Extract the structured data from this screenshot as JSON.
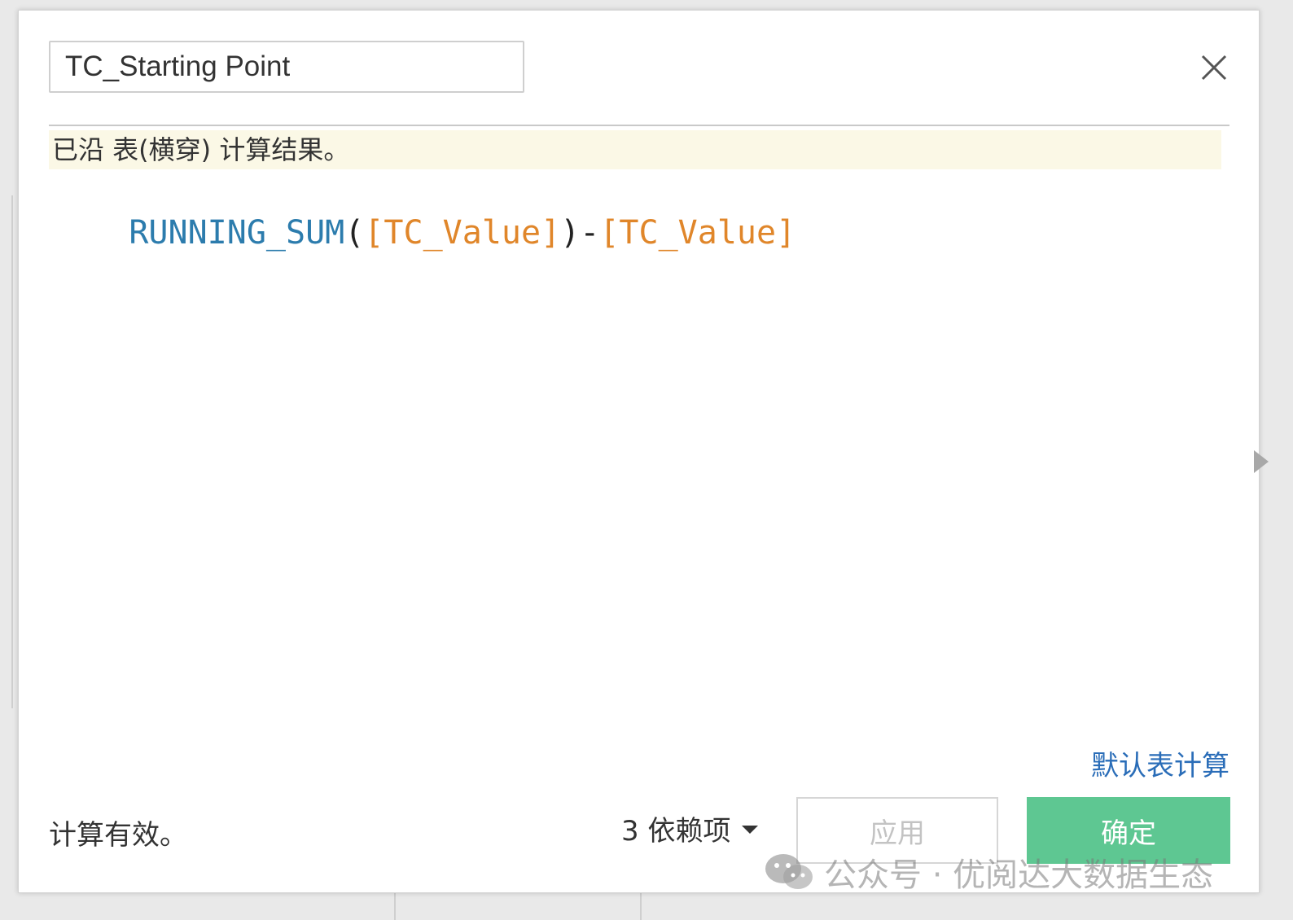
{
  "dialog": {
    "name_field_value": "TC_Starting Point",
    "info_banner": "已沿 表(横穿) 计算结果。",
    "formula": {
      "func": "RUNNING_SUM",
      "open": "(",
      "field1": "[TC_Value]",
      "close_minus": ")-",
      "field2": "[TC_Value]"
    },
    "default_calc_link": "默认表计算",
    "status": "计算有效。",
    "dependencies": "3 依赖项",
    "apply_label": "应用",
    "ok_label": "确定"
  },
  "watermark": {
    "text": "公众号 · 优阅达大数据生态"
  },
  "colors": {
    "func": "#2c7cad",
    "field": "#e0862a",
    "ok_button": "#5ec792",
    "link": "#2a6db8",
    "banner": "#fbf8e6"
  },
  "icons": {
    "close": "close-icon",
    "dropdown": "caret-down-icon",
    "side": "arrow-right-icon",
    "watermark": "wechat-icon"
  }
}
